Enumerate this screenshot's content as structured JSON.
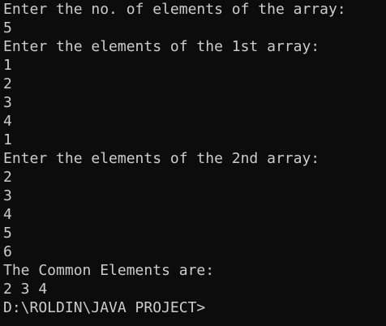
{
  "terminal": {
    "lines": [
      "Enter the no. of elements of the array:",
      "5",
      "Enter the elements of the 1st array:",
      "1",
      "2",
      "3",
      "4",
      "1",
      "Enter the elements of the 2nd array:",
      "2",
      "3",
      "4",
      "5",
      "6",
      "The Common Elements are:",
      "2 3 4",
      "D:\\ROLDIN\\JAVA PROJECT>"
    ]
  },
  "colors": {
    "background": "#0c0c0c",
    "text": "#cccccc"
  }
}
